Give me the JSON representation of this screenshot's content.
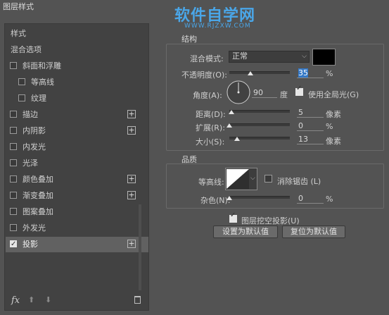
{
  "window": {
    "title": "图层样式"
  },
  "watermark": {
    "text": "软件自学网",
    "url": "WWW.RJZXW.COM"
  },
  "sidebar": {
    "items": [
      {
        "label": "样式",
        "checkbox": false,
        "checked": false,
        "plus": false,
        "indent": 0,
        "selected": false
      },
      {
        "label": "混合选项",
        "checkbox": false,
        "checked": false,
        "plus": false,
        "indent": 0,
        "selected": false
      },
      {
        "label": "斜面和浮雕",
        "checkbox": true,
        "checked": false,
        "plus": false,
        "indent": 0,
        "selected": false
      },
      {
        "label": "等高线",
        "checkbox": true,
        "checked": false,
        "plus": false,
        "indent": 1,
        "selected": false
      },
      {
        "label": "纹理",
        "checkbox": true,
        "checked": false,
        "plus": false,
        "indent": 1,
        "selected": false
      },
      {
        "label": "描边",
        "checkbox": true,
        "checked": false,
        "plus": true,
        "indent": 0,
        "selected": false
      },
      {
        "label": "内阴影",
        "checkbox": true,
        "checked": false,
        "plus": true,
        "indent": 0,
        "selected": false
      },
      {
        "label": "内发光",
        "checkbox": true,
        "checked": false,
        "plus": false,
        "indent": 0,
        "selected": false
      },
      {
        "label": "光泽",
        "checkbox": true,
        "checked": false,
        "plus": false,
        "indent": 0,
        "selected": false
      },
      {
        "label": "颜色叠加",
        "checkbox": true,
        "checked": false,
        "plus": true,
        "indent": 0,
        "selected": false
      },
      {
        "label": "渐变叠加",
        "checkbox": true,
        "checked": false,
        "plus": true,
        "indent": 0,
        "selected": false
      },
      {
        "label": "图案叠加",
        "checkbox": true,
        "checked": false,
        "plus": false,
        "indent": 0,
        "selected": false
      },
      {
        "label": "外发光",
        "checkbox": true,
        "checked": false,
        "plus": false,
        "indent": 0,
        "selected": false
      },
      {
        "label": "投影",
        "checkbox": true,
        "checked": true,
        "plus": true,
        "indent": 0,
        "selected": true
      }
    ],
    "footer": {
      "fx": "fx",
      "up": "⬆",
      "down": "⬇",
      "trash": "🗑"
    }
  },
  "structure": {
    "title": "结构",
    "blend_mode_label": "混合模式:",
    "blend_mode_value": "正常",
    "blend_color": "#000000",
    "opacity_label": "不透明度(O):",
    "opacity_value": "35",
    "opacity_unit": "%",
    "opacity_level": 0.35,
    "angle_label": "角度(A):",
    "angle_value": "90",
    "angle_unit": "度",
    "global_light_label": "使用全局光(G)",
    "global_light_checked": true,
    "distance_label": "距离(D):",
    "distance_value": "5",
    "distance_unit": "像素",
    "spread_label": "扩展(R):",
    "spread_value": "0",
    "spread_unit": "%",
    "size_label": "大小(S):",
    "size_value": "13",
    "size_unit": "像素"
  },
  "quality": {
    "title": "品质",
    "contour_label": "等高线:",
    "antialias_label": "消除锯齿 (L)",
    "antialias_checked": false,
    "noise_label": "杂色(N):",
    "noise_value": "0",
    "noise_unit": "%"
  },
  "knockout": {
    "label": "图层挖空投影(U)",
    "checked": true
  },
  "buttons": {
    "set_default": "设置为默认值",
    "reset_default": "复位为默认值"
  },
  "colors": {
    "accent_selection": "#3478c6",
    "watermark": "#4aa6e8"
  }
}
